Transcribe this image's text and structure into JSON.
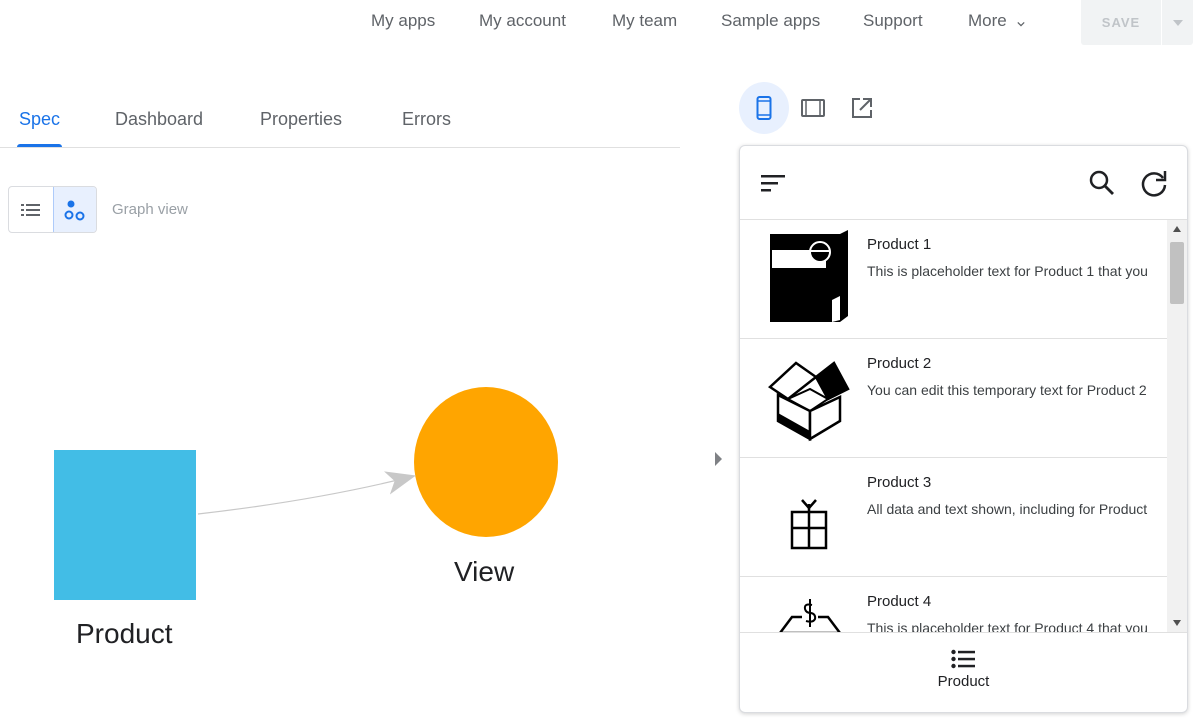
{
  "topnav": {
    "links": [
      "My apps",
      "My account",
      "My team",
      "Sample apps",
      "Support",
      "More"
    ],
    "save_label": "SAVE"
  },
  "tabs": [
    {
      "label": "Spec",
      "active": true
    },
    {
      "label": "Dashboard"
    },
    {
      "label": "Properties"
    },
    {
      "label": "Errors"
    }
  ],
  "view_toggle": {
    "mode_label": "Graph view",
    "options": [
      "list-icon",
      "graph-icon"
    ],
    "selected": "graph-icon"
  },
  "graph": {
    "nodes": [
      {
        "label": "Product",
        "shape": "square",
        "color": "#42bde6"
      },
      {
        "label": "View",
        "shape": "circle",
        "color": "#ffa500"
      }
    ],
    "edge_color": "#c8c8c8"
  },
  "preview": {
    "device_options": [
      "phone-icon",
      "tablet-icon",
      "open-in-new-icon"
    ],
    "selected_device": "phone-icon",
    "header_icons": [
      "sort-icon",
      "search-icon",
      "refresh-icon"
    ],
    "items": [
      {
        "title": "Product 1",
        "desc": "This is placeholder text for Product 1 that you",
        "image": "box-icon"
      },
      {
        "title": "Product 2",
        "desc": "You can edit this temporary text for Product 2",
        "image": "open-box-icon"
      },
      {
        "title": "Product 3",
        "desc": "All data and text shown, including for Product",
        "image": "gift-icon"
      },
      {
        "title": "Product 4",
        "desc": "This is placeholder text for Product 4 that you",
        "image": "money-tray-icon"
      }
    ],
    "bottom_nav": {
      "label": "Product",
      "icon": "list-bullets-icon"
    }
  },
  "colors": {
    "accent": "#1a73e8",
    "accent_bg": "#e8f0fe"
  }
}
